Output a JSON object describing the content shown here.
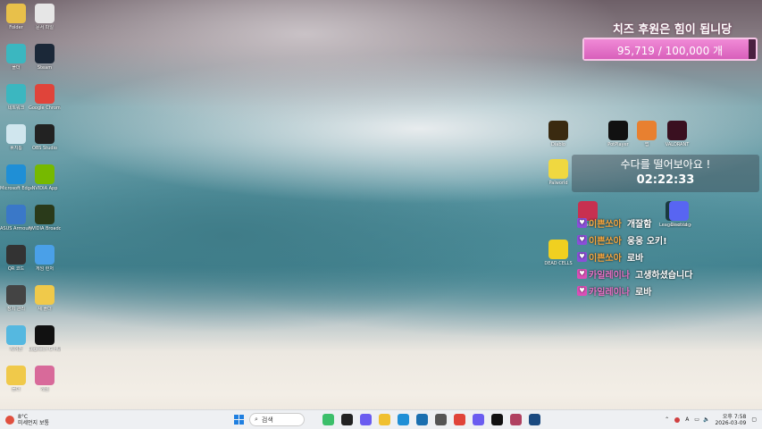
{
  "desktop_icons": [
    {
      "label": "Folder",
      "color": "#e8c04a"
    },
    {
      "label": "문서 파일",
      "color": "#e6e6e6"
    },
    {
      "label": "폴더",
      "color": "#3bb7c0"
    },
    {
      "label": "Steam",
      "color": "#1b2838"
    },
    {
      "label": "네트워크",
      "color": "#3bb7c0"
    },
    {
      "label": "Google Chrome",
      "color": "#e0443a"
    },
    {
      "label": "휴지통",
      "color": "#d0e6ee"
    },
    {
      "label": "OBS Studio",
      "color": "#222222"
    },
    {
      "label": "Microsoft Edge",
      "color": "#1f8fd6"
    },
    {
      "label": "NVIDIA App",
      "color": "#76b900"
    },
    {
      "label": "ASUS Armoury",
      "color": "#3a78c8"
    },
    {
      "label": "NVIDIA Broadcast",
      "color": "#2a3a1a"
    },
    {
      "label": "QR 코드",
      "color": "#333333"
    },
    {
      "label": "게임 런처",
      "color": "#4aa0e8"
    },
    {
      "label": "장치 관리",
      "color": "#444444"
    },
    {
      "label": "새 폴더",
      "color": "#f0c94a"
    },
    {
      "label": "제어판",
      "color": "#55b8e0"
    },
    {
      "label": "Logitech G HUB",
      "color": "#111111"
    },
    {
      "label": "폴더",
      "color": "#f0c94a"
    },
    {
      "label": "게임",
      "color": "#d86a9a"
    }
  ],
  "right_icons": [
    {
      "label": "Diablo",
      "color": "#3a2a10"
    },
    {
      "label": "PotPlayer",
      "color": "#111111"
    },
    {
      "label": "앱",
      "color": "#e88030"
    },
    {
      "label": "VALORANT",
      "color": "#3a1020"
    },
    {
      "label": "Palworld",
      "color": "#f0d840"
    },
    {
      "label": "League of Legends",
      "color": "#1a3a40"
    },
    {
      "label": "Apex",
      "color": "#c83050"
    },
    {
      "label": "Discord",
      "color": "#5865f2"
    },
    {
      "label": "DEAD CELLS",
      "color": "#f0d020"
    }
  ],
  "goal": {
    "title": "치즈 후원은 힘이 됩니당",
    "current": 95719,
    "target": 100000,
    "text": "95,719 / 100,000 개",
    "fraction": 0.957,
    "accent": "#e27acb"
  },
  "timer": {
    "title": "수다를 떨어보아요 !",
    "time": "02:22:33"
  },
  "chat": [
    {
      "nick": "이쁜쏘아",
      "message": "개잘함",
      "nick_color": "#f4a640",
      "badge": "purple"
    },
    {
      "nick": "이쁜쏘아",
      "message": "웅웅 오키!",
      "nick_color": "#f4a640",
      "badge": "purple"
    },
    {
      "nick": "이쁜쏘아",
      "message": "로바",
      "nick_color": "#f4a640",
      "badge": "purple"
    },
    {
      "nick": "카일레이나",
      "message": "고생하셨습니다",
      "nick_color": "#e873c8",
      "badge": "pink"
    },
    {
      "nick": "카일레이나",
      "message": "로바",
      "nick_color": "#e873c8",
      "badge": "pink"
    }
  ],
  "taskbar": {
    "weather_temp": "8°C",
    "weather_text": "미세먼지 보통",
    "search_placeholder": "검색",
    "apps": [
      {
        "name": "widgets",
        "color": "#3cbf6a"
      },
      {
        "name": "terminal",
        "color": "#222"
      },
      {
        "name": "copilot",
        "color": "#6a5cf0"
      },
      {
        "name": "file-explorer",
        "color": "#f0c030"
      },
      {
        "name": "edge",
        "color": "#1f8fd6"
      },
      {
        "name": "store",
        "color": "#1a6fb0"
      },
      {
        "name": "app",
        "color": "#555"
      },
      {
        "name": "chrome",
        "color": "#e0443a"
      },
      {
        "name": "discord",
        "color": "#6a5cf0"
      },
      {
        "name": "potplayer",
        "color": "#111"
      },
      {
        "name": "game",
        "color": "#b04060"
      },
      {
        "name": "steam",
        "color": "#1b4a80"
      }
    ],
    "time": "오후 7:58",
    "date": "2026-03-09",
    "lang": "A"
  }
}
